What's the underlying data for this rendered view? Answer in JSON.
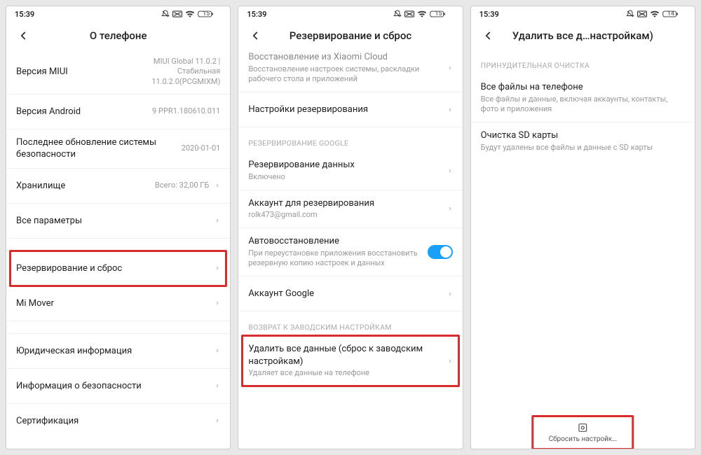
{
  "statusbar": {
    "time": "15:39",
    "battery1": "15",
    "battery3": "14"
  },
  "screen1": {
    "title": "О телефоне",
    "rows": [
      {
        "label": "Версия MIUI",
        "value": "MIUI Global 11.0.2 | Стабильная 11.0.2.0(PCGMIXM)"
      },
      {
        "label": "Версия Android",
        "value": "9 PPR1.180610.011"
      },
      {
        "label": "Последнее обновление системы безопасности",
        "value": "2020-01-01"
      },
      {
        "label": "Хранилище",
        "value": "Всего: 32,00 ГБ"
      },
      {
        "label": "Все параметры"
      },
      {
        "label": "Резервирование и сброс",
        "highlighted": true
      },
      {
        "label": "Mi Mover"
      },
      {
        "label": "Юридическая информация"
      },
      {
        "label": "Информация о безопасности"
      },
      {
        "label": "Сертификация"
      }
    ]
  },
  "screen2": {
    "title": "Резервирование и сброс",
    "r0": {
      "label": "Восстановление из Xiaomi Cloud",
      "sub": "Восстановление настроек системы, раскладки рабочего стола и приложений"
    },
    "r1": {
      "label": "Настройки резервирования"
    },
    "sec1": "РЕЗЕРВИРОВАНИЕ GOOGLE",
    "r2": {
      "label": "Резервирование данных",
      "sub": "Включено"
    },
    "r3": {
      "label": "Аккаунт для резервирования",
      "sub": "rolk473@gmail.com"
    },
    "r4": {
      "label": "Автовосстановление",
      "sub": "При переустановке приложения восстановить резервную копию настроек и данных"
    },
    "r5": {
      "label": "Аккаунт Google"
    },
    "sec2": "ВОЗВРАТ К ЗАВОДСКИМ НАСТРОЙКАМ",
    "r6": {
      "label": "Удалить все данные (сброс к заводским настройкам)",
      "sub": "Удаляет все данные на телефоне",
      "highlighted": true
    }
  },
  "screen3": {
    "title": "Удалить все д…настройкам)",
    "sec1": "ПРИНУДИТЕЛЬНАЯ ОЧИСТКА",
    "r0": {
      "label": "Все файлы на телефоне",
      "sub": "Все файлы и данные, включая аккаунты, контакты, фото и приложения"
    },
    "r1": {
      "label": "Очистка SD карты",
      "sub": "Будут удалены все файлы и данные с SD карты"
    },
    "button": "Сбросить настройк…"
  }
}
